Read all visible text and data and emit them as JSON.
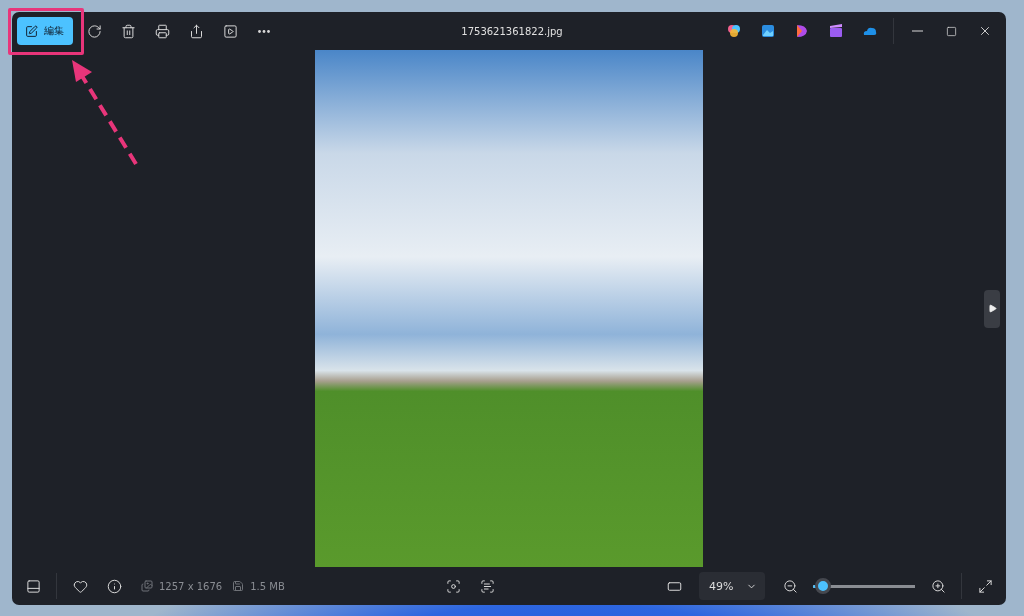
{
  "window": {
    "title": "1753621361822.jpg"
  },
  "toolbar": {
    "edit_button": {
      "label": "編集"
    }
  },
  "info": {
    "dimensions": "1257 x 1676",
    "file_size": "1.5 MB"
  },
  "zoom": {
    "value": "49%",
    "level": 0.1
  }
}
